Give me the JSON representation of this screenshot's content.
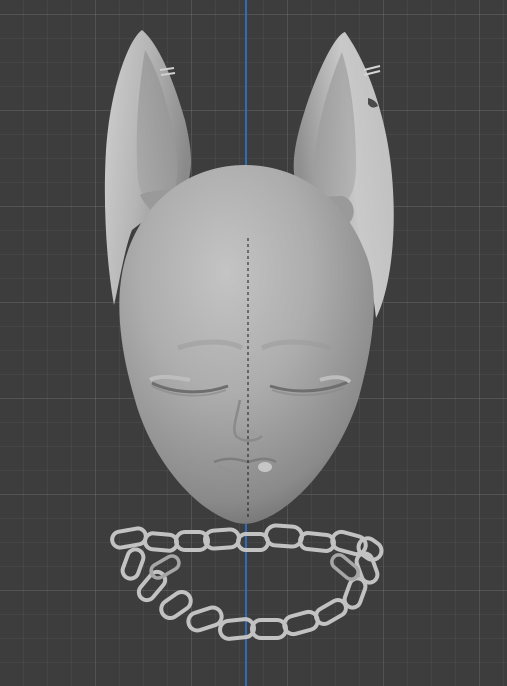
{
  "viewport": {
    "background_color": "#3d3d3d",
    "grid_color": "#4a4a4a",
    "axis_color": "#2e6fbf",
    "model_color": "#a9a9a9"
  },
  "scene": {
    "objects": [
      "head-mesh",
      "left-ear-mesh",
      "right-ear-mesh",
      "chain-mesh"
    ]
  }
}
